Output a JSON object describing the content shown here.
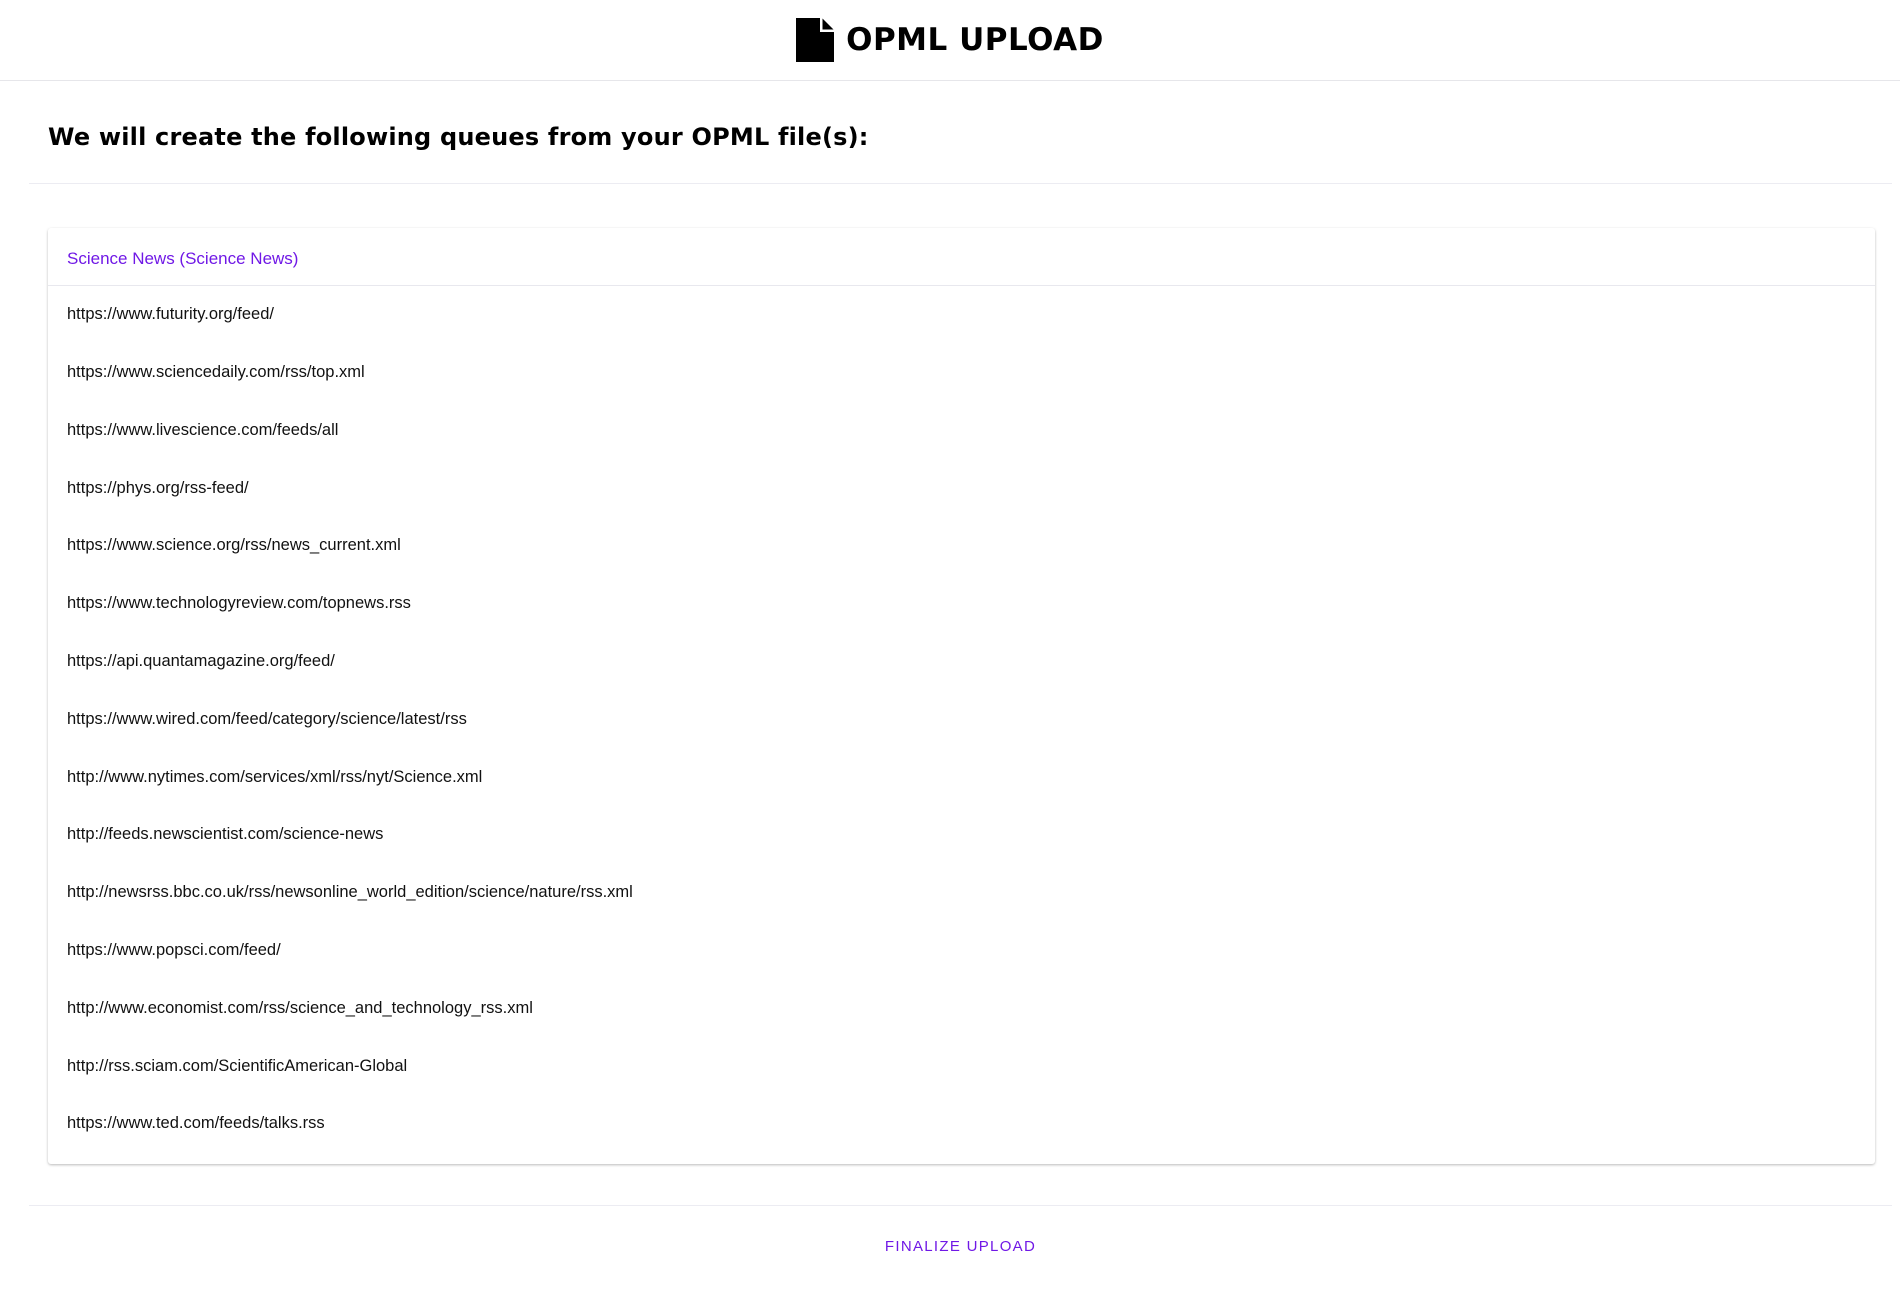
{
  "header": {
    "icon": "file-icon",
    "title": "OPML UPLOAD"
  },
  "subheader": {
    "heading": "We will create the following queues from your OPML file(s):"
  },
  "queue": {
    "title": "Science News (Science News)",
    "accent_color": "#7018e6",
    "feeds": [
      "https://www.futurity.org/feed/",
      "https://www.sciencedaily.com/rss/top.xml",
      "https://www.livescience.com/feeds/all",
      "https://phys.org/rss-feed/",
      "https://www.science.org/rss/news_current.xml",
      "https://www.technologyreview.com/topnews.rss",
      "https://api.quantamagazine.org/feed/",
      "https://www.wired.com/feed/category/science/latest/rss",
      "http://www.nytimes.com/services/xml/rss/nyt/Science.xml",
      "http://feeds.newscientist.com/science-news",
      "http://newsrss.bbc.co.uk/rss/newsonline_world_edition/science/nature/rss.xml",
      "https://www.popsci.com/feed/",
      "http://www.economist.com/rss/science_and_technology_rss.xml",
      "http://rss.sciam.com/ScientificAmerican-Global",
      "https://www.ted.com/feeds/talks.rss"
    ]
  },
  "footer": {
    "finalize_label": "FINALIZE UPLOAD"
  }
}
